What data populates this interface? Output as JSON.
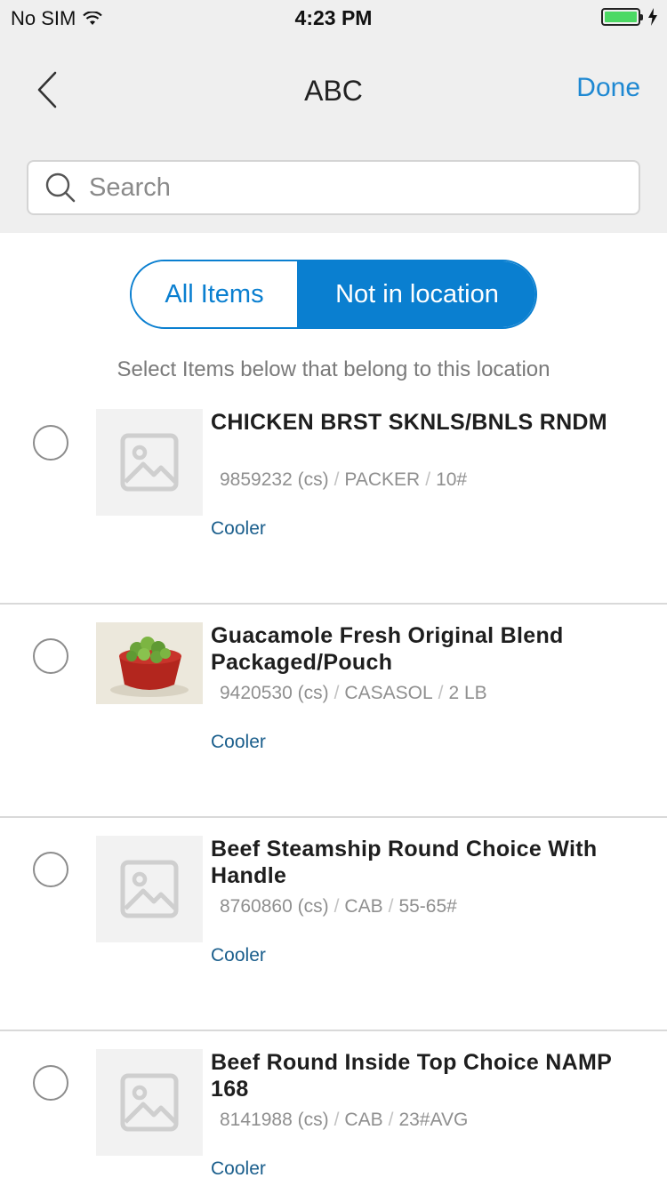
{
  "status_bar": {
    "carrier": "No SIM",
    "time": "4:23 PM"
  },
  "nav": {
    "title": "ABC",
    "done_label": "Done"
  },
  "search": {
    "placeholder": "Search",
    "value": ""
  },
  "segment": {
    "all_items": "All Items",
    "not_in_location": "Not in location",
    "selected": "not_in_location"
  },
  "hint": "Select Items below that belong to this location",
  "items": [
    {
      "name": "CHICKEN BRST SKNLS/BNLS RNDM",
      "code": "9859232 (cs)",
      "brand": "PACKER",
      "pack": "10#",
      "location": "Cooler",
      "image": "placeholder-image-icon",
      "selected": false
    },
    {
      "name": "Guacamole Fresh Original Blend Packaged/Pouch",
      "code": "9420530 (cs)",
      "brand": "CASASOL",
      "pack": "2 LB",
      "location": "Cooler",
      "image": "guacamole-photo",
      "selected": false
    },
    {
      "name": "Beef Steamship Round Choice With Handle",
      "code": "8760860 (cs)",
      "brand": "CAB",
      "pack": "55-65#",
      "location": "Cooler",
      "image": "placeholder-image-icon",
      "selected": false
    },
    {
      "name": "Beef Round Inside Top Choice NAMP 168",
      "code": "8141988 (cs)",
      "brand": "CAB",
      "pack": "23#AVG",
      "location": "Cooler",
      "image": "placeholder-image-icon",
      "selected": false
    }
  ],
  "colors": {
    "accent": "#0a7fd0",
    "done": "#1e88d2",
    "location_link": "#1a5e8c",
    "battery": "#4cd964"
  }
}
